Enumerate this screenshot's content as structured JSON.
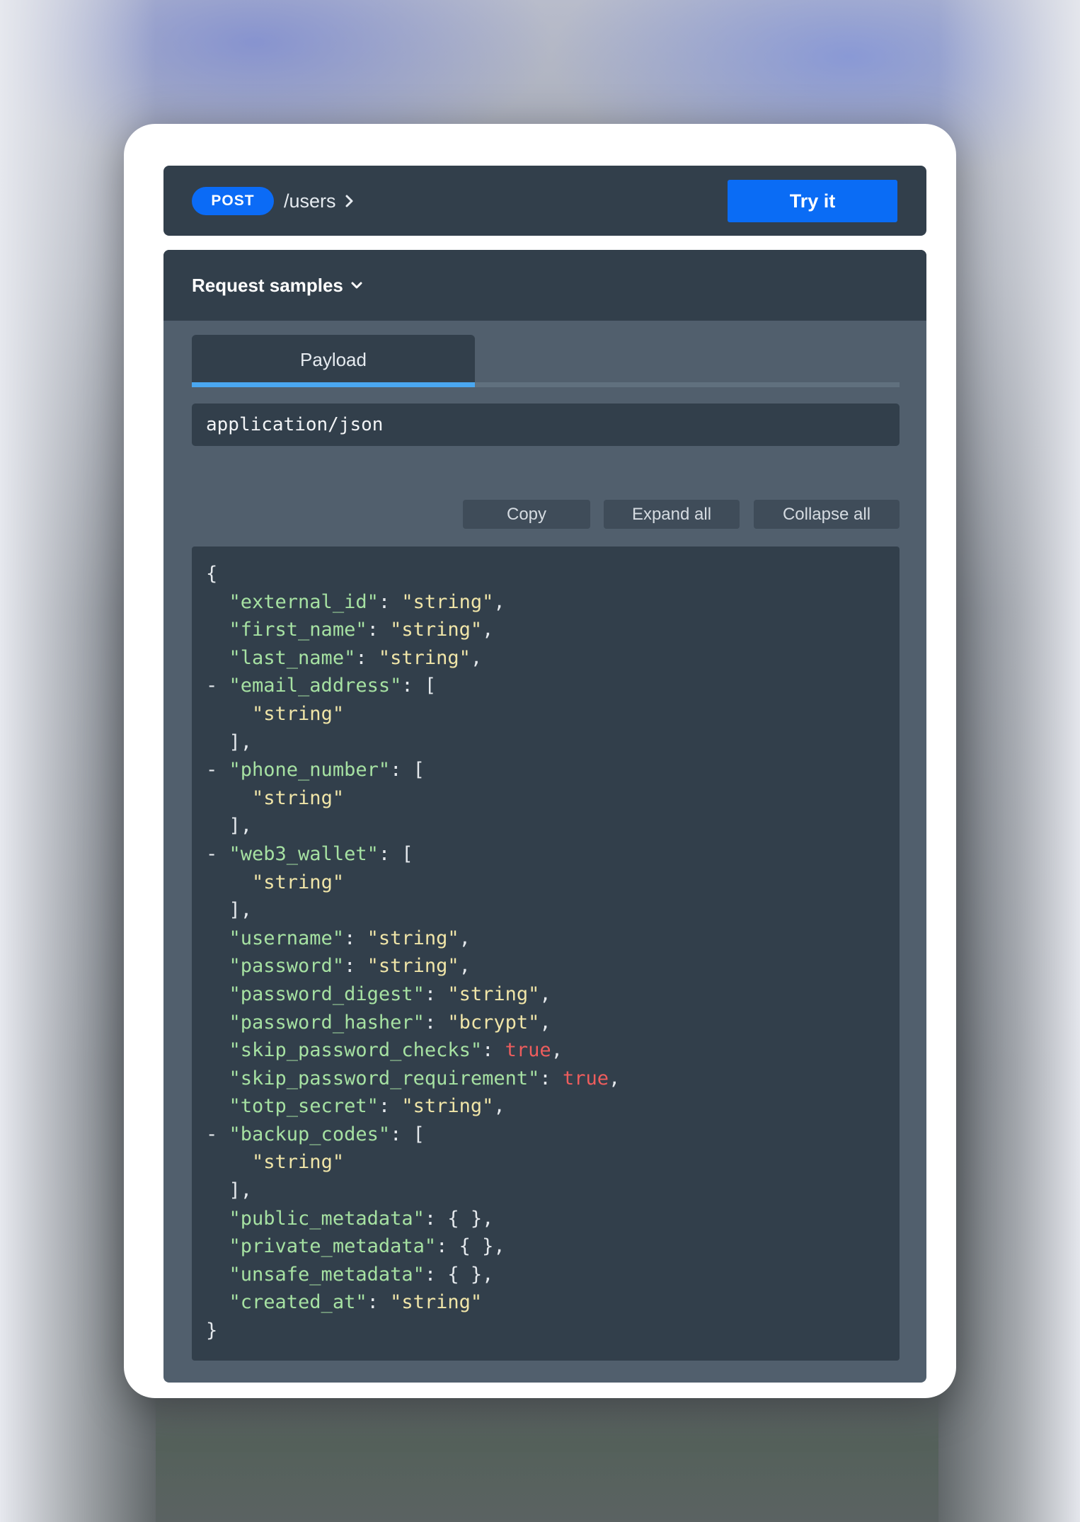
{
  "endpoint": {
    "method": "POST",
    "path": "/users",
    "try_button": "Try it"
  },
  "samples": {
    "title": "Request samples",
    "tabs": [
      {
        "label": "Payload",
        "active": true
      }
    ],
    "content_type": "application/json",
    "toolbar": {
      "copy": "Copy",
      "expand_all": "Expand all",
      "collapse_all": "Collapse all"
    }
  },
  "payload": {
    "open_brace": "{",
    "close_brace": "}",
    "fields": [
      {
        "key": "external_id",
        "type": "string",
        "value": "string"
      },
      {
        "key": "first_name",
        "type": "string",
        "value": "string"
      },
      {
        "key": "last_name",
        "type": "string",
        "value": "string"
      },
      {
        "key": "email_address",
        "type": "array",
        "items": [
          "string"
        ]
      },
      {
        "key": "phone_number",
        "type": "array",
        "items": [
          "string"
        ]
      },
      {
        "key": "web3_wallet",
        "type": "array",
        "items": [
          "string"
        ]
      },
      {
        "key": "username",
        "type": "string",
        "value": "string"
      },
      {
        "key": "password",
        "type": "string",
        "value": "string"
      },
      {
        "key": "password_digest",
        "type": "string",
        "value": "string"
      },
      {
        "key": "password_hasher",
        "type": "string",
        "value": "bcrypt"
      },
      {
        "key": "skip_password_checks",
        "type": "boolean",
        "value": "true"
      },
      {
        "key": "skip_password_requirement",
        "type": "boolean",
        "value": "true"
      },
      {
        "key": "totp_secret",
        "type": "string",
        "value": "string"
      },
      {
        "key": "backup_codes",
        "type": "array",
        "items": [
          "string"
        ]
      },
      {
        "key": "public_metadata",
        "type": "object",
        "value": "{ }"
      },
      {
        "key": "private_metadata",
        "type": "object",
        "value": "{ }"
      },
      {
        "key": "unsafe_metadata",
        "type": "object",
        "value": "{ }"
      },
      {
        "key": "created_at",
        "type": "string",
        "value": "string"
      }
    ]
  },
  "colors": {
    "method_badge": "#0b6bf6",
    "try_button": "#0a6cf5",
    "panel_dark": "#323f4b",
    "panel_mid": "#515f6d",
    "tab_underline": "#4aa7f0",
    "json_key": "#a6e1a2",
    "json_string": "#f0e5a8",
    "json_boolean": "#ee5d5d"
  },
  "icons": {
    "path_chevron": "chevron-right-icon",
    "samples_chevron": "chevron-down-icon",
    "collapse_toggle": "minus-toggle"
  }
}
